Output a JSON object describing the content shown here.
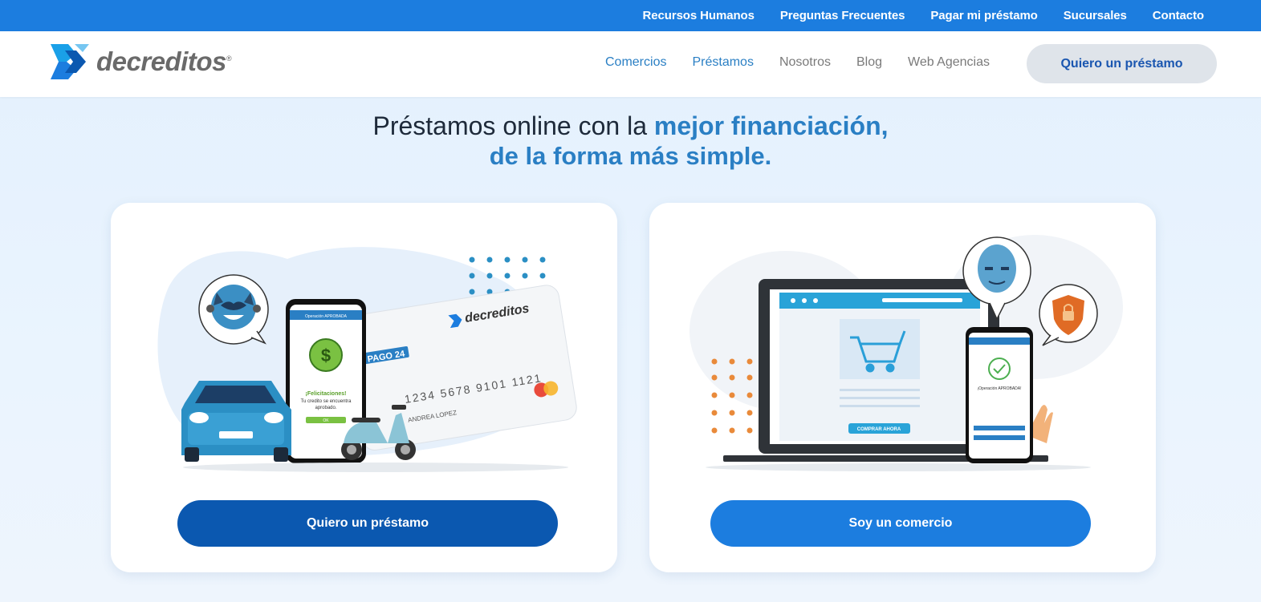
{
  "topbar": {
    "links": [
      "Recursos Humanos",
      "Preguntas Frecuentes",
      "Pagar mi préstamo",
      "Sucursales",
      "Contacto"
    ]
  },
  "logo": {
    "text": "decreditos",
    "mark": "®"
  },
  "nav": {
    "items": [
      "Comercios",
      "Préstamos",
      "Nosotros",
      "Blog",
      "Web Agencias"
    ],
    "cta": "Quiero un préstamo"
  },
  "hero": {
    "line1_a": "Préstamos online con la ",
    "line1_b": "mejor financiación,",
    "line2": "de la forma más simple."
  },
  "cards": {
    "loan": {
      "button": "Quiero un préstamo",
      "phone_header": "Operación APROBADA",
      "congrats": "¡Felicitaciones!",
      "approved_a": "Tu credito se encuentra",
      "approved_b": "aprobado.",
      "ok": "OK",
      "card_brand": "decreditos",
      "card_tag": "PAGO 24",
      "card_number": "1234 5678 9101 1121",
      "card_name": "ANDREA LOPEZ"
    },
    "merchant": {
      "button": "Soy un comercio",
      "buy_button": "COMPRAR AHORA",
      "phone_status": "¡Operación APROBADA!"
    }
  },
  "colors": {
    "topbar": "#1c7ddf",
    "accent": "#2a7fc4",
    "loan_button": "#0b58b0",
    "merchant_button": "#1c7ddf"
  }
}
